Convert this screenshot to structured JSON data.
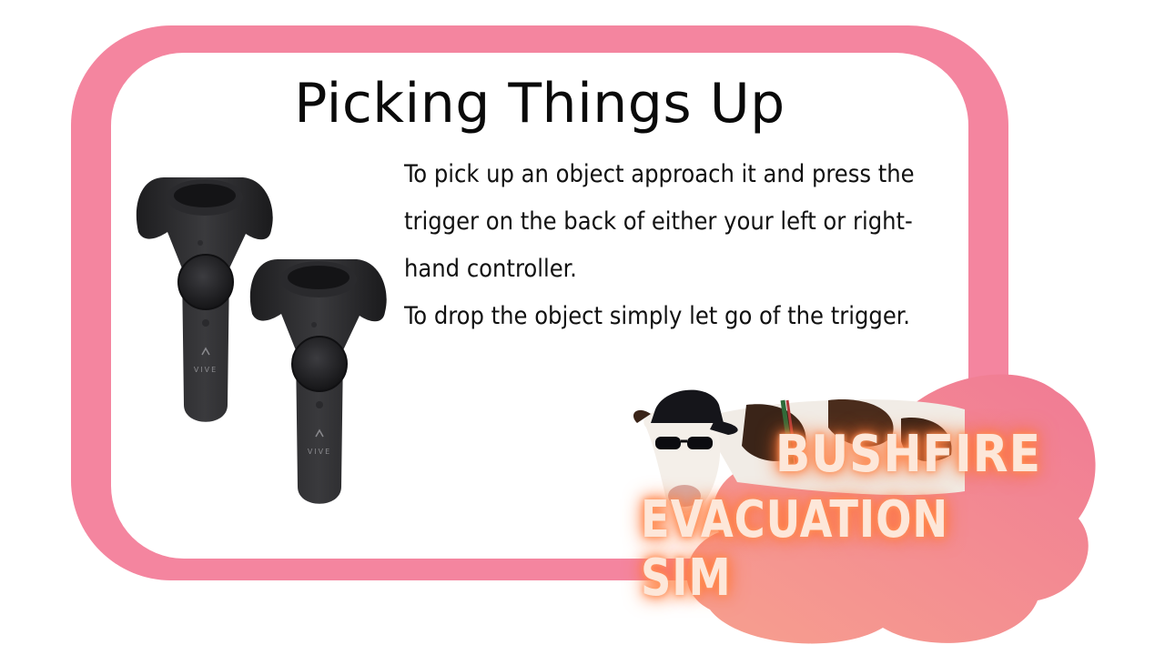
{
  "slide": {
    "title": "Picking Things Up",
    "paragraphs": [
      "To pick up an object approach it and press the trigger on the back of either your left or right-hand controller.",
      "To drop the object simply let go of the trigger."
    ]
  },
  "controllers": {
    "brand_label": "VIVE",
    "icon": "vr-controller-icon"
  },
  "logo": {
    "line1": "BUSHFIRE",
    "line2": "EVACUATION SIM"
  },
  "colors": {
    "frame": "#f4859f",
    "card": "#ffffff",
    "blob_light": "#f7a08e",
    "blob_dark": "#f07a95",
    "logo_text": "#fde7d9",
    "logo_glow": "#ff7a3c"
  }
}
